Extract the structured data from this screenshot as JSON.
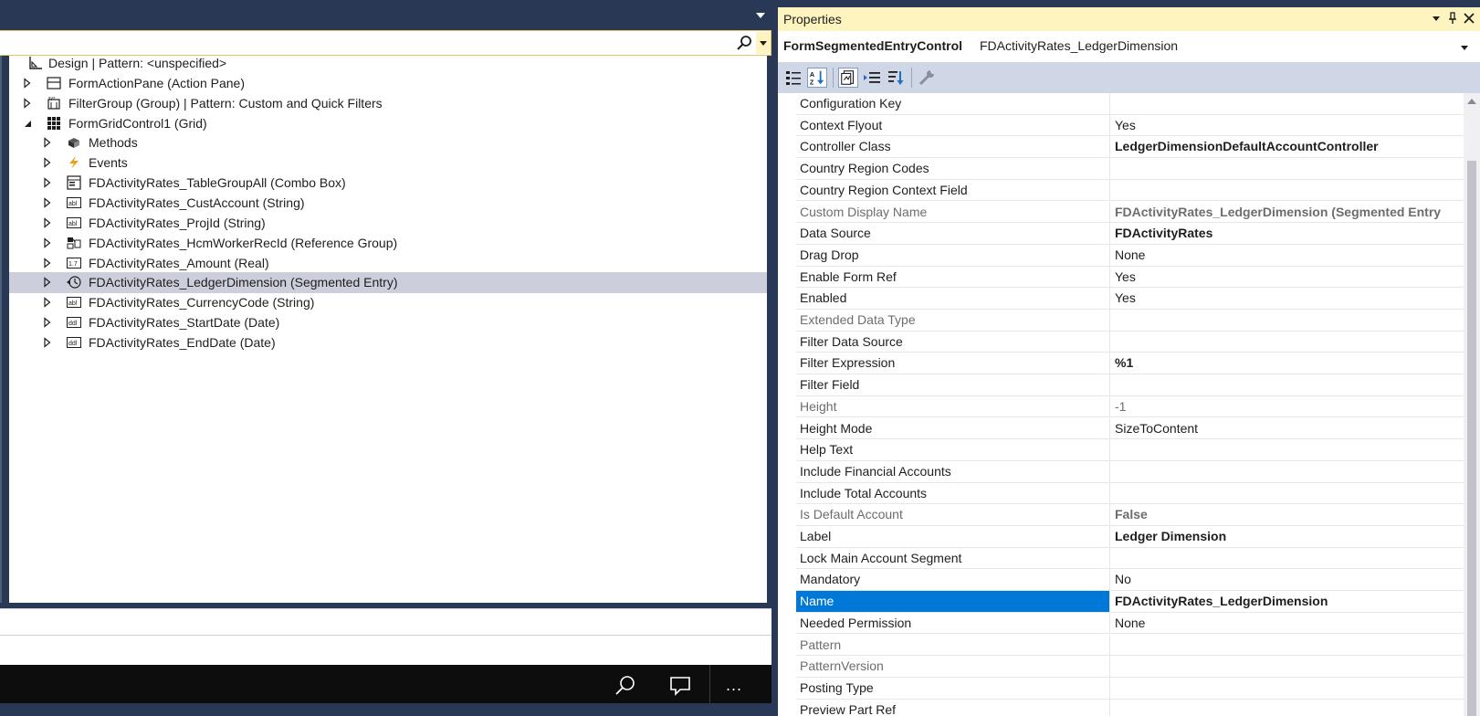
{
  "designer": {
    "search": {
      "value": "",
      "placeholder": ""
    },
    "tree": [
      {
        "label": "Design | Pattern: <unspecified>",
        "icon": "design-icon",
        "level": 0,
        "expander": "none"
      },
      {
        "label": "FormActionPane (Action Pane)",
        "icon": "action-pane-icon",
        "level": 1,
        "expander": "collapsed"
      },
      {
        "label": "FilterGroup (Group) | Pattern: Custom and Quick Filters",
        "icon": "group-icon",
        "level": 1,
        "expander": "collapsed"
      },
      {
        "label": "FormGridControl1 (Grid)",
        "icon": "grid-icon",
        "level": 1,
        "expander": "expanded"
      },
      {
        "label": "Methods",
        "icon": "methods-icon",
        "level": 2,
        "expander": "collapsed"
      },
      {
        "label": "Events",
        "icon": "events-icon",
        "level": 2,
        "expander": "collapsed"
      },
      {
        "label": "FDActivityRates_TableGroupAll (Combo Box)",
        "icon": "combo-box-icon",
        "level": 2,
        "expander": "collapsed"
      },
      {
        "label": "FDActivityRates_CustAccount (String)",
        "icon": "string-icon",
        "level": 2,
        "expander": "collapsed"
      },
      {
        "label": "FDActivityRates_ProjId (String)",
        "icon": "string-icon",
        "level": 2,
        "expander": "collapsed"
      },
      {
        "label": "FDActivityRates_HcmWorkerRecId (Reference Group)",
        "icon": "reference-group-icon",
        "level": 2,
        "expander": "collapsed"
      },
      {
        "label": "FDActivityRates_Amount (Real)",
        "icon": "real-icon",
        "level": 2,
        "expander": "collapsed"
      },
      {
        "label": "FDActivityRates_LedgerDimension (Segmented Entry)",
        "icon": "segmented-entry-icon",
        "level": 2,
        "expander": "collapsed",
        "selected": true
      },
      {
        "label": "FDActivityRates_CurrencyCode (String)",
        "icon": "string-icon",
        "level": 2,
        "expander": "collapsed"
      },
      {
        "label": "FDActivityRates_StartDate (Date)",
        "icon": "date-icon",
        "level": 2,
        "expander": "collapsed"
      },
      {
        "label": "FDActivityRates_EndDate (Date)",
        "icon": "date-icon",
        "level": 2,
        "expander": "collapsed"
      }
    ]
  },
  "taskbar": {
    "more_label": "..."
  },
  "properties": {
    "title": "Properties",
    "header": {
      "type": "FormSegmentedEntryControl",
      "name": "FDActivityRates_LedgerDimension"
    },
    "rows": [
      {
        "name": "Configuration Key",
        "value": "",
        "bold": false,
        "disabled": false
      },
      {
        "name": "Context Flyout",
        "value": "Yes",
        "bold": false,
        "disabled": false
      },
      {
        "name": "Controller Class",
        "value": "LedgerDimensionDefaultAccountController",
        "bold": true,
        "disabled": false
      },
      {
        "name": "Country Region Codes",
        "value": "",
        "bold": false,
        "disabled": false
      },
      {
        "name": "Country Region Context Field",
        "value": "",
        "bold": false,
        "disabled": false
      },
      {
        "name": "Custom Display Name",
        "value": "FDActivityRates_LedgerDimension (Segmented Entry",
        "bold": true,
        "disabled": true
      },
      {
        "name": "Data Source",
        "value": "FDActivityRates",
        "bold": true,
        "disabled": false
      },
      {
        "name": "Drag Drop",
        "value": "None",
        "bold": false,
        "disabled": false
      },
      {
        "name": "Enable Form Ref",
        "value": "Yes",
        "bold": false,
        "disabled": false
      },
      {
        "name": "Enabled",
        "value": "Yes",
        "bold": false,
        "disabled": false
      },
      {
        "name": "Extended Data Type",
        "value": "",
        "bold": false,
        "disabled": true
      },
      {
        "name": "Filter Data Source",
        "value": "",
        "bold": false,
        "disabled": false
      },
      {
        "name": "Filter Expression",
        "value": "%1",
        "bold": true,
        "disabled": false
      },
      {
        "name": "Filter Field",
        "value": "",
        "bold": false,
        "disabled": false
      },
      {
        "name": "Height",
        "value": "-1",
        "bold": false,
        "disabled": true
      },
      {
        "name": "Height Mode",
        "value": "SizeToContent",
        "bold": false,
        "disabled": false
      },
      {
        "name": "Help Text",
        "value": "",
        "bold": false,
        "disabled": false
      },
      {
        "name": "Include Financial Accounts",
        "value": "",
        "bold": false,
        "disabled": false
      },
      {
        "name": "Include Total Accounts",
        "value": "",
        "bold": false,
        "disabled": false
      },
      {
        "name": "Is Default Account",
        "value": "False",
        "bold": true,
        "disabled": true
      },
      {
        "name": "Label",
        "value": "Ledger Dimension",
        "bold": true,
        "disabled": false
      },
      {
        "name": "Lock Main Account Segment",
        "value": "",
        "bold": false,
        "disabled": false
      },
      {
        "name": "Mandatory",
        "value": "No",
        "bold": false,
        "disabled": false
      },
      {
        "name": "Name",
        "value": "FDActivityRates_LedgerDimension",
        "bold": true,
        "disabled": false,
        "selected": true
      },
      {
        "name": "Needed Permission",
        "value": "None",
        "bold": false,
        "disabled": false
      },
      {
        "name": "Pattern",
        "value": "",
        "bold": false,
        "disabled": true
      },
      {
        "name": "PatternVersion",
        "value": "",
        "bold": false,
        "disabled": true
      },
      {
        "name": "Posting Type",
        "value": "",
        "bold": false,
        "disabled": false
      },
      {
        "name": "Preview Part Ref",
        "value": "",
        "bold": false,
        "disabled": false
      }
    ]
  },
  "colors": {
    "chrome": "#293955",
    "title_active": "#fdf4bf",
    "selection_blue": "#0078d7",
    "tree_selected": "#cccedb",
    "toolbar": "#cfd6e5"
  }
}
